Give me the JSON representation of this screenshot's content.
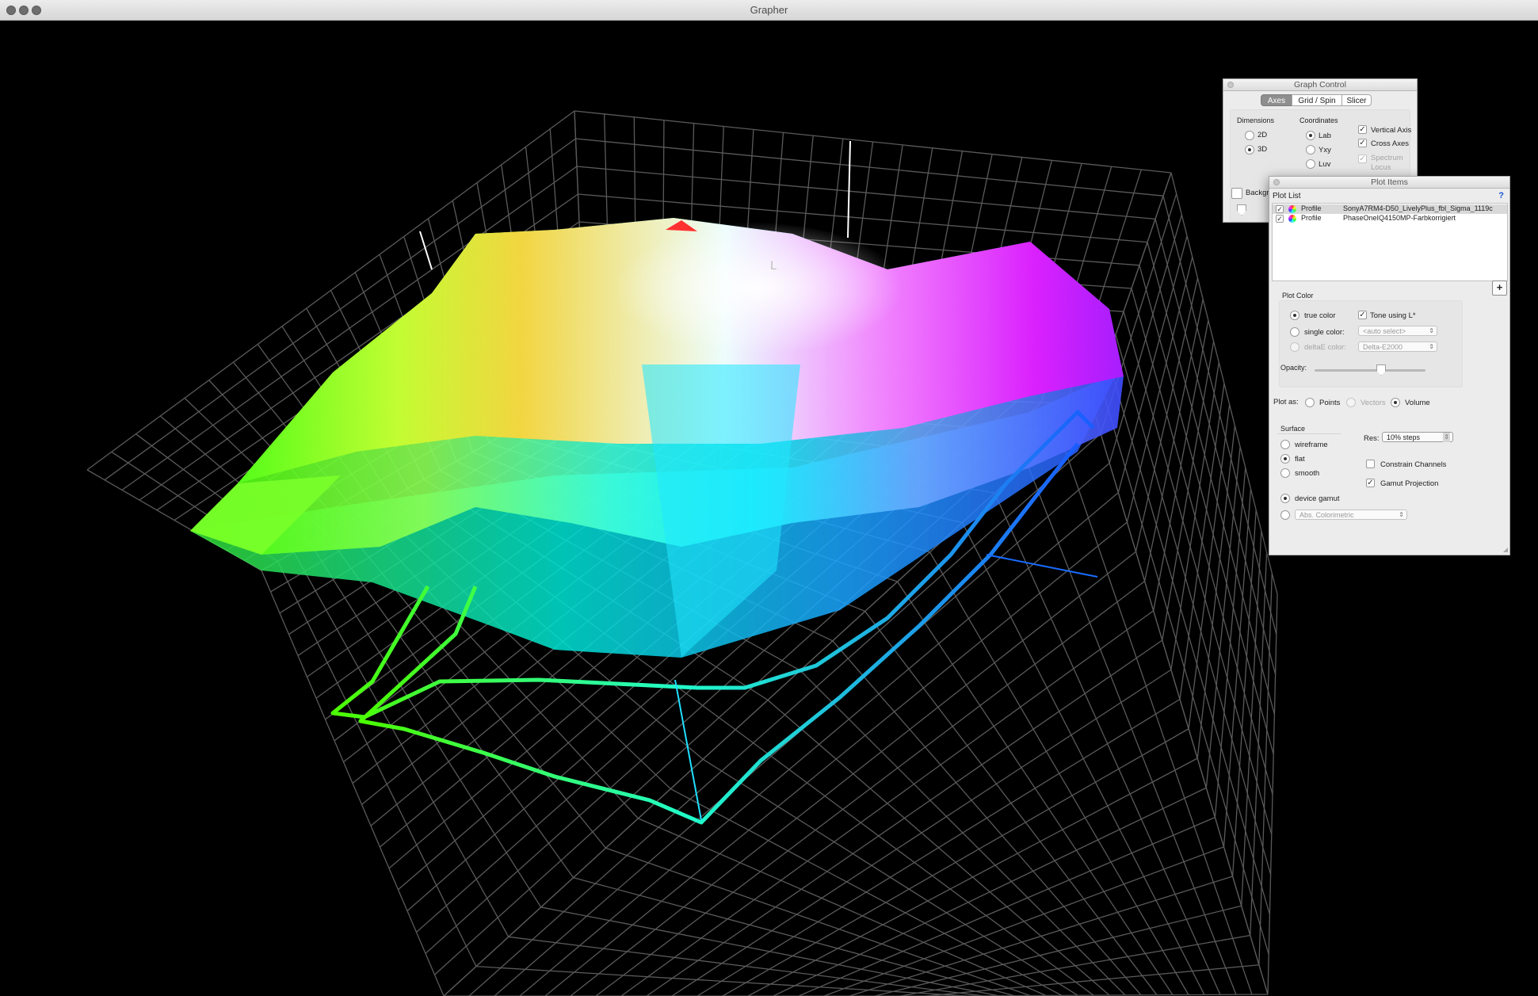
{
  "window": {
    "title": "Grapher"
  },
  "graph_control": {
    "title": "Graph Control",
    "tabs": [
      {
        "label": "Axes",
        "selected": true
      },
      {
        "label": "Grid / Spin",
        "selected": false
      },
      {
        "label": "Slicer",
        "selected": false
      }
    ],
    "dimensions": {
      "heading": "Dimensions",
      "options": [
        {
          "label": "2D",
          "selected": false
        },
        {
          "label": "3D",
          "selected": true
        }
      ]
    },
    "coordinates": {
      "heading": "Coordinates",
      "options": [
        {
          "label": "Lab",
          "selected": true
        },
        {
          "label": "Yxy",
          "selected": false
        },
        {
          "label": "Luv",
          "selected": false
        }
      ]
    },
    "toggles": [
      {
        "label": "Vertical Axis",
        "checked": true,
        "enabled": true
      },
      {
        "label": "Cross Axes",
        "checked": true,
        "enabled": true
      },
      {
        "label": "Spectrum",
        "label2": "Locus",
        "checked": true,
        "enabled": false
      }
    ],
    "background_label": "Backgr"
  },
  "plot_items": {
    "title": "Plot Items",
    "plot_list_heading": "Plot List",
    "help": "?",
    "items": [
      {
        "type": "Profile",
        "name": "SonyA7RM4-D50_LivelyPlus_fbl_Sigma_1119c",
        "checked": true,
        "selected": true
      },
      {
        "type": "Profile",
        "name": "PhaseOneIQ4150MP-Farbkorrigiert",
        "checked": true,
        "selected": false
      }
    ],
    "add_button": "+",
    "plot_color": {
      "heading": "Plot Color",
      "true_color": {
        "label": "true color",
        "selected": true
      },
      "single_color": {
        "label": "single color:",
        "selected": false,
        "value": "<auto select>"
      },
      "deltae_color": {
        "label": "deltaE color:",
        "selected": false,
        "value": "Delta-E2000"
      },
      "tone_using": {
        "label": "Tone using L*",
        "checked": true
      },
      "opacity_label": "Opacity:",
      "opacity": 0.6
    },
    "plot_as": {
      "label": "Plot as:",
      "options": [
        {
          "label": "Points",
          "selected": false,
          "enabled": true
        },
        {
          "label": "Vectors",
          "selected": false,
          "enabled": false
        },
        {
          "label": "Volume",
          "selected": true,
          "enabled": true
        }
      ]
    },
    "surface": {
      "heading": "Surface",
      "options": [
        {
          "label": "wireframe",
          "selected": false
        },
        {
          "label": "flat",
          "selected": true
        },
        {
          "label": "smooth",
          "selected": false
        }
      ]
    },
    "res": {
      "label": "Res:",
      "value": "10% steps"
    },
    "constrain_channels": {
      "label": "Constrain Channels",
      "checked": false
    },
    "gamut_projection": {
      "label": "Gamut Projection",
      "checked": true
    },
    "device_gamut": {
      "label": "device gamut",
      "selected": true
    },
    "intent": {
      "value": "Abs. Colorimetric",
      "selected": false
    }
  },
  "graph": {
    "vertical_axis_label": "L"
  },
  "colors": {
    "background": "#000000",
    "grid": "#5a5a5a",
    "panel": "#ececec"
  }
}
